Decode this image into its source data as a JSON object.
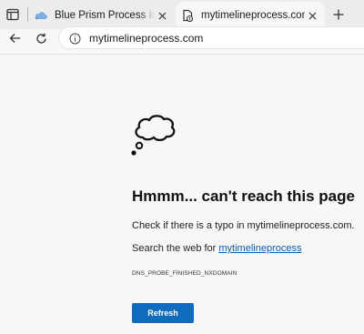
{
  "tabs": [
    {
      "title": "Blue Prism Process Intelligence: S",
      "favicon": "cloud-icon",
      "active": false
    },
    {
      "title": "mytimelineprocess.com",
      "favicon": "page-error-icon",
      "active": true
    }
  ],
  "toolbar": {
    "url": "mytimelineprocess.com"
  },
  "error_page": {
    "headline": "Hmmm... can't reach this page",
    "typo_text": "Check if there is a typo in mytimelineprocess.com.",
    "search_prefix": "Search the web for ",
    "search_link": "mytimelineprocess",
    "error_code": "DNS_PROBE_FINISHED_NXDOMAIN",
    "refresh_label": "Refresh"
  },
  "colors": {
    "accent": "#0f6cbd",
    "link": "#0b5cad",
    "page_bg": "#f7f7f7"
  }
}
